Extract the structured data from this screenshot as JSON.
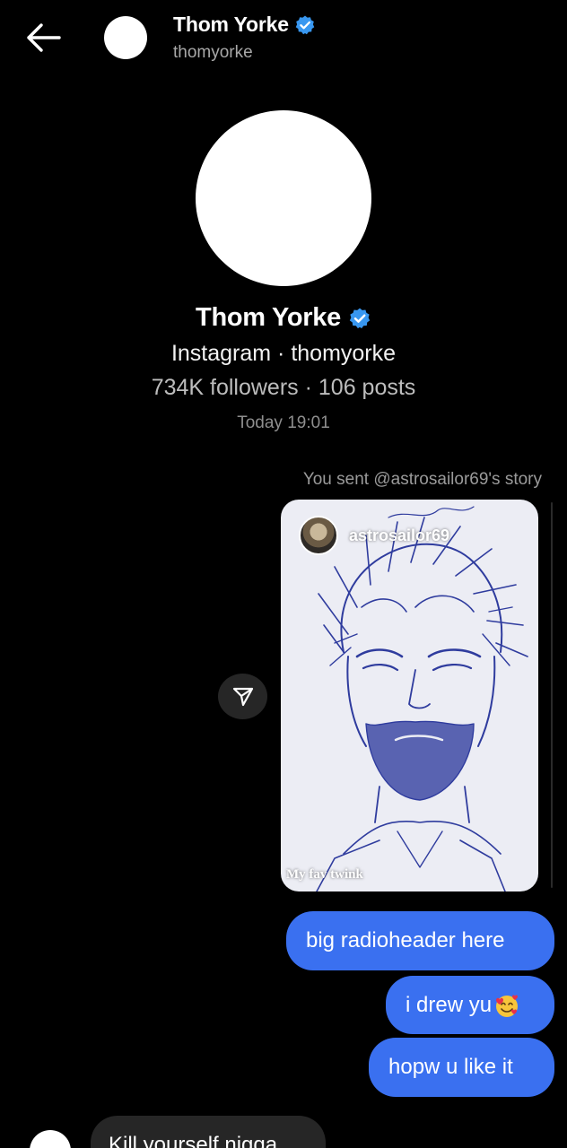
{
  "header": {
    "back_icon": "arrow-left-icon",
    "name": "Thom Yorke",
    "handle": "thomyorke",
    "verified_color": "#3897f0"
  },
  "profile": {
    "name": "Thom Yorke",
    "source": "Instagram · thomyorke",
    "stats": "734K followers · 106 posts"
  },
  "thread": {
    "timestamp": "Today 19:01",
    "story_caption": "You sent @astrosailor69's story",
    "story": {
      "username": "astrosailor69",
      "text": "My fav twink",
      "share_icon": "send-icon"
    },
    "messages": [
      {
        "direction": "outgoing",
        "text": "big radioheader here"
      },
      {
        "direction": "outgoing",
        "text": "i drew yu",
        "emoji": "smiling-face-with-hearts"
      },
      {
        "direction": "outgoing",
        "text": "hopw u like it"
      },
      {
        "direction": "incoming",
        "text": "Kill yourself nigga"
      }
    ]
  },
  "colors": {
    "background": "#000000",
    "outgoing_bubble": "#3a70f0",
    "incoming_bubble": "#262626",
    "secondary_text": "#a8a8a8"
  }
}
